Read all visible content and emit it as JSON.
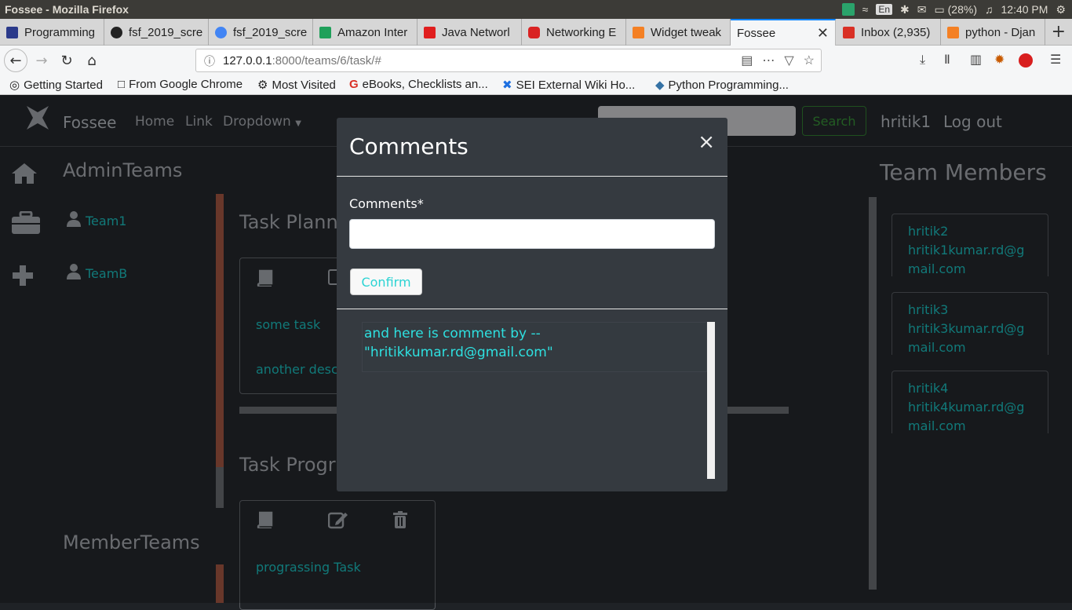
{
  "os": {
    "window_title": "Fossee - Mozilla Firefox",
    "lang": "En",
    "battery": "(28%)",
    "time": "12:40 PM"
  },
  "tabs": [
    {
      "label": "Programming"
    },
    {
      "label": "fsf_2019_scre"
    },
    {
      "label": "fsf_2019_scre"
    },
    {
      "label": "Amazon Inter"
    },
    {
      "label": "Java Networl"
    },
    {
      "label": "Networking E"
    },
    {
      "label": "Widget tweak"
    },
    {
      "label": "Fossee"
    },
    {
      "label": "Inbox (2,935)"
    },
    {
      "label": "python - Djan"
    }
  ],
  "url": {
    "host": "127.0.0.1",
    "path": ":8000/teams/6/task/#"
  },
  "bookmarks": [
    {
      "label": "Getting Started"
    },
    {
      "label": "From Google Chrome"
    },
    {
      "label": "Most Visited"
    },
    {
      "label": "eBooks, Checklists an..."
    },
    {
      "label": "SEI External Wiki Ho..."
    },
    {
      "label": "Python Programming..."
    }
  ],
  "site": {
    "brand": "Fossee",
    "nav": {
      "home": "Home",
      "link": "Link",
      "dropdown": "Dropdown"
    },
    "search_button": "Search",
    "username": "hritik1",
    "logout": "Log out",
    "admin_teams_title": "AdminTeams",
    "member_teams_title": "MemberTeams",
    "admin_teams": [
      "Team1",
      "TeamB"
    ],
    "task_planned_title": "Task Plann",
    "task_progress_title": "Task Progr",
    "planned_tasks": [
      "some task",
      "another desc"
    ],
    "progress_tasks": [
      "prograssing Task"
    ],
    "team_members_title": "Team Members",
    "members": [
      {
        "name": "hritik2",
        "email_l1": "hritik1kumar.rd@g",
        "email_l2": "mail.com"
      },
      {
        "name": "hritik3",
        "email_l1": "hritik3kumar.rd@g",
        "email_l2": "mail.com"
      },
      {
        "name": "hritik4",
        "email_l1": "hritik4kumar.rd@g",
        "email_l2": "mail.com"
      }
    ]
  },
  "modal": {
    "title": "Comments",
    "close": "×",
    "field_label": "Comments*",
    "input_value": "",
    "confirm": "Confirm",
    "comment_line1": "and here is comment by --",
    "comment_line2": "\"hritikkumar.rd@gmail.com\""
  }
}
